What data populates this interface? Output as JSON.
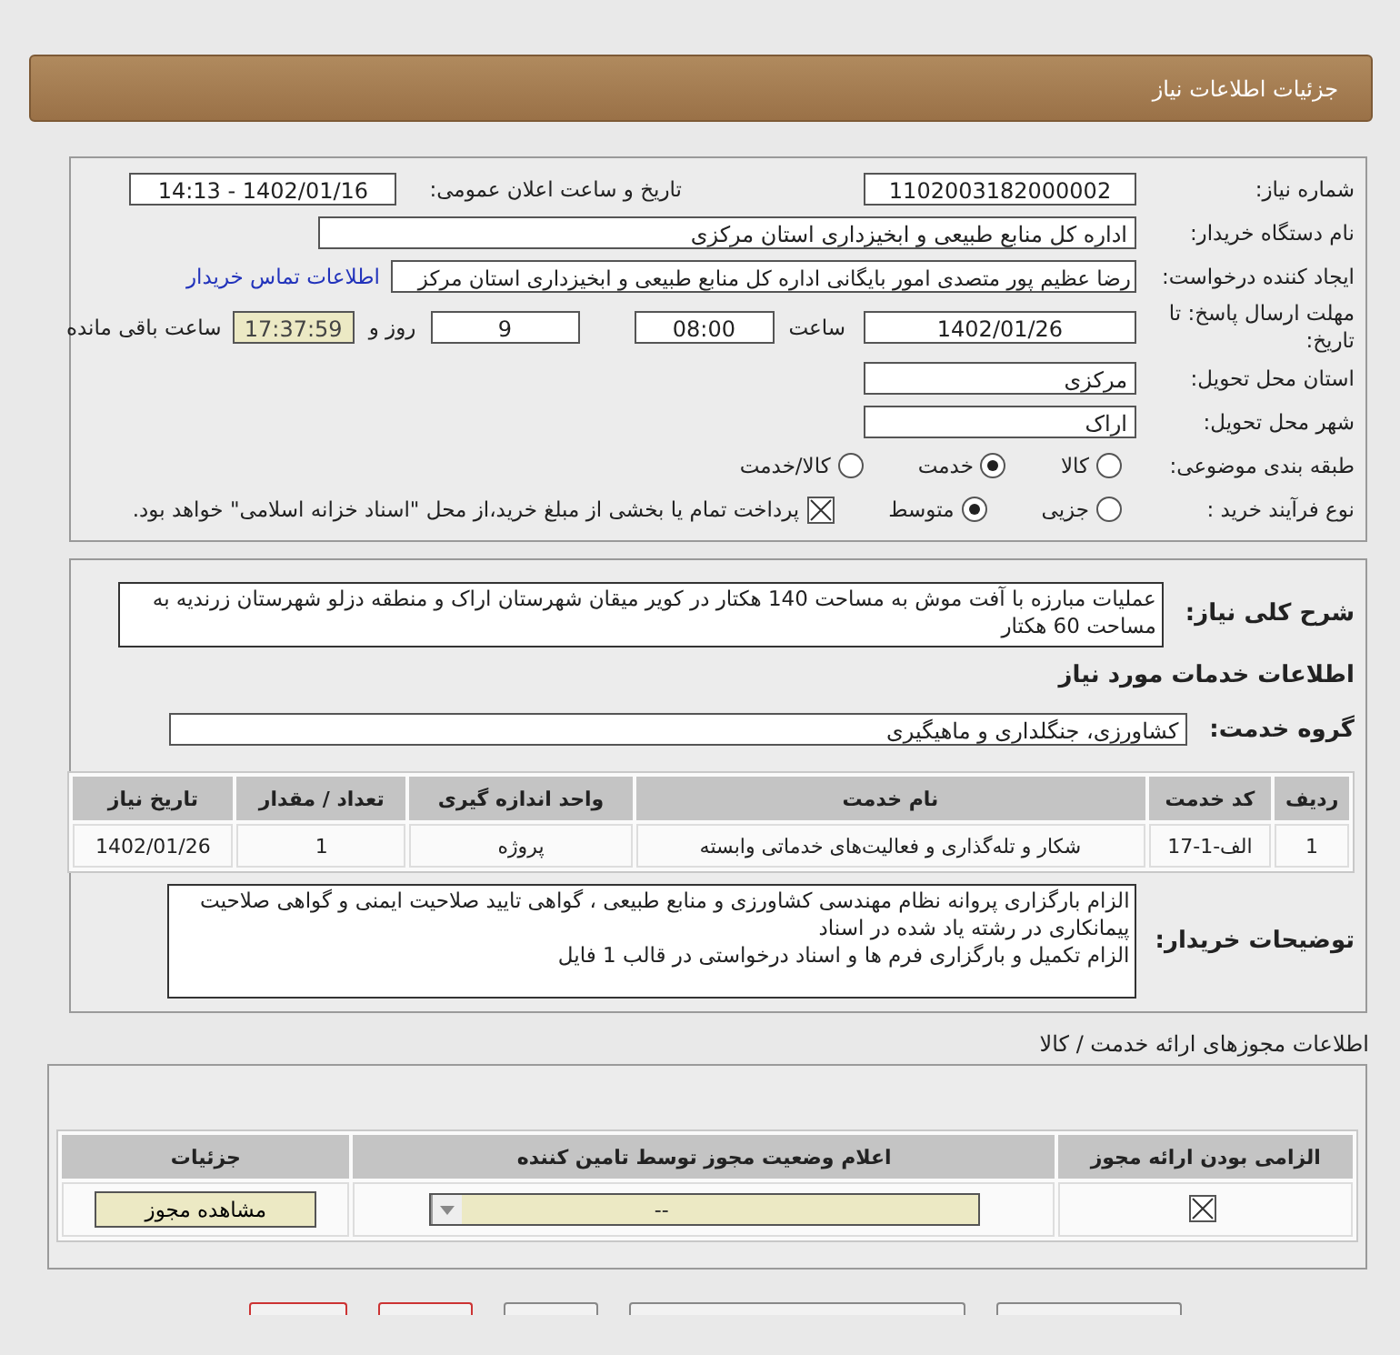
{
  "header": {
    "title": "جزئیات اطلاعات نیاز"
  },
  "details": {
    "need_number": {
      "label": "شماره نیاز:",
      "value": "1102003182000002"
    },
    "announce": {
      "label": "تاریخ و ساعت اعلان عمومی:",
      "value": "1402/01/16 - 14:13"
    },
    "buyer_org": {
      "label": "نام دستگاه خریدار:",
      "value": "اداره کل منابع طبیعی و ابخیزداری استان مرکزی"
    },
    "requester": {
      "label": "ایجاد کننده درخواست:",
      "value": "رضا عظیم پور متصدی امور بایگانی اداره کل منابع طبیعی و ابخیزداری استان مرکز",
      "link": "اطلاعات تماس خریدار"
    },
    "deadline": {
      "label": "مهلت ارسال پاسخ: تا تاریخ:",
      "date": "1402/01/26",
      "time_label": "ساعت",
      "time": "08:00",
      "days": "9",
      "days_label": "روز و",
      "remaining": "17:37:59",
      "remaining_label": "ساعت باقی مانده"
    },
    "province": {
      "label": "استان محل تحویل:",
      "value": "مرکزی"
    },
    "city": {
      "label": "شهر محل تحویل:",
      "value": "اراک"
    },
    "category": {
      "label": "طبقه بندی موضوعی:",
      "options": [
        {
          "label": "کالا",
          "selected": false
        },
        {
          "label": "خدمت",
          "selected": true
        },
        {
          "label": "کالا/خدمت",
          "selected": false
        }
      ]
    },
    "process": {
      "label": "نوع فرآیند خرید :",
      "options": [
        {
          "label": "جزیی",
          "selected": false
        },
        {
          "label": "متوسط",
          "selected": true
        }
      ],
      "treasury": {
        "checked": true,
        "text": "پرداخت تمام یا بخشی از مبلغ خرید،از محل \"اسناد خزانه اسلامی\" خواهد بود."
      }
    }
  },
  "need": {
    "description": {
      "label": "شرح کلی نیاز:",
      "text": "عملیات مبارزه با آفت موش به مساحت 140 هکتار در کویر میقان شهرستان اراک و منطقه دزلو شهرستان زرندیه به مساحت 60 هکتار"
    },
    "services_heading": "اطلاعات خدمات مورد نیاز",
    "service_group": {
      "label": "گروه خدمت:",
      "value": "کشاورزی، جنگلداری و ماهیگیری"
    },
    "table": {
      "columns": [
        "ردیف",
        "کد خدمت",
        "نام خدمت",
        "واحد اندازه گیری",
        "تعداد / مقدار",
        "تاریخ نیاز"
      ],
      "rows": [
        [
          "1",
          "الف-1-17",
          "شکار و تله‌گذاری و فعالیت‌های خدماتی وابسته",
          "پروژه",
          "1",
          "1402/01/26"
        ]
      ]
    },
    "buyer_notes": {
      "label": "توضیحات خریدار:",
      "lines": [
        "الزام بارگزاری پروانه نظام مهندسی کشاورزی و منابع طبیعی ، گواهی تایید صلاحیت ایمنی و گواهی صلاحیت پیمانکاری در رشته یاد شده در اسناد",
        "الزام تکمیل و بارگزاری فرم ها و اسناد درخواستی در قالب 1 فایل"
      ]
    }
  },
  "licenses": {
    "title": "اطلاعات مجوزهای ارائه خدمت / کالا",
    "columns": [
      "الزامی بودن ارائه مجوز",
      "اعلام وضعیت مجوز توسط تامین کننده",
      "جزئیات"
    ],
    "rows": [
      {
        "required": true,
        "status": "--",
        "action": "مشاهده مجوز"
      }
    ]
  },
  "footer_buttons": [
    {
      "color": "#cc3333"
    },
    {
      "color": "#cc3333"
    },
    {
      "color": "#888888"
    },
    {
      "color": "#888888"
    },
    {
      "color": "#888888"
    }
  ]
}
